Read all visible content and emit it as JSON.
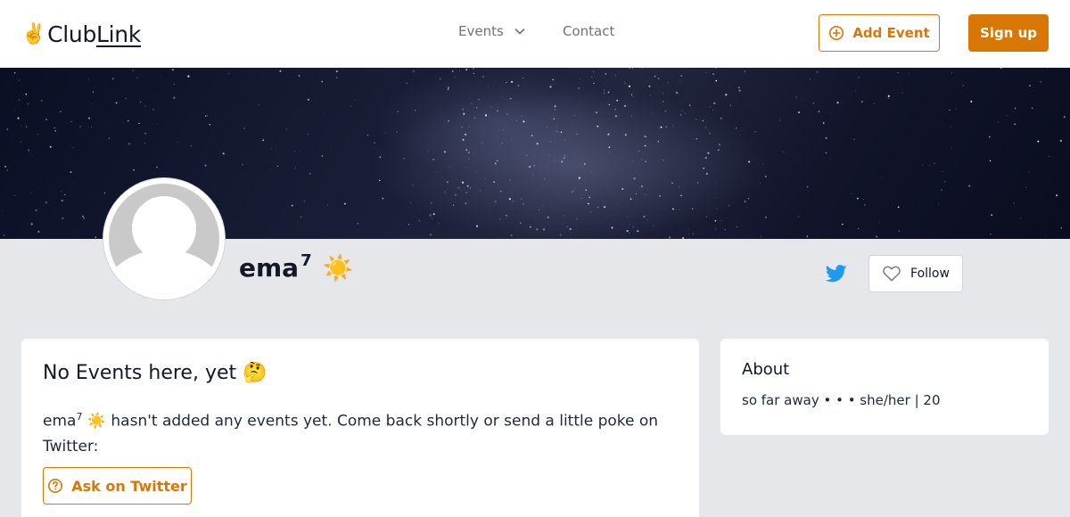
{
  "header": {
    "logo_emoji": "✌️",
    "logo_text_a": "Club",
    "logo_text_b": "Link",
    "nav_events": "Events",
    "nav_contact": "Contact",
    "add_event_label": "Add Event",
    "signup_label": "Sign up"
  },
  "profile": {
    "name": "ema",
    "name_sup": "7",
    "name_emoji": "☀️",
    "follow_label": "Follow"
  },
  "main_card": {
    "title": "No Events here, yet 🤔",
    "text_name": "ema",
    "text_sup": "7",
    "text_rest": " ☀️ hasn't added any events yet. Come back shortly or send a little poke on Twitter:",
    "ask_label": "Ask on Twitter"
  },
  "about": {
    "title": "About",
    "text": "so far away • • • she/her | 20"
  },
  "colors": {
    "accent": "#d97706",
    "twitter": "#1d9bf0",
    "page_bg": "#e5e7eb"
  }
}
